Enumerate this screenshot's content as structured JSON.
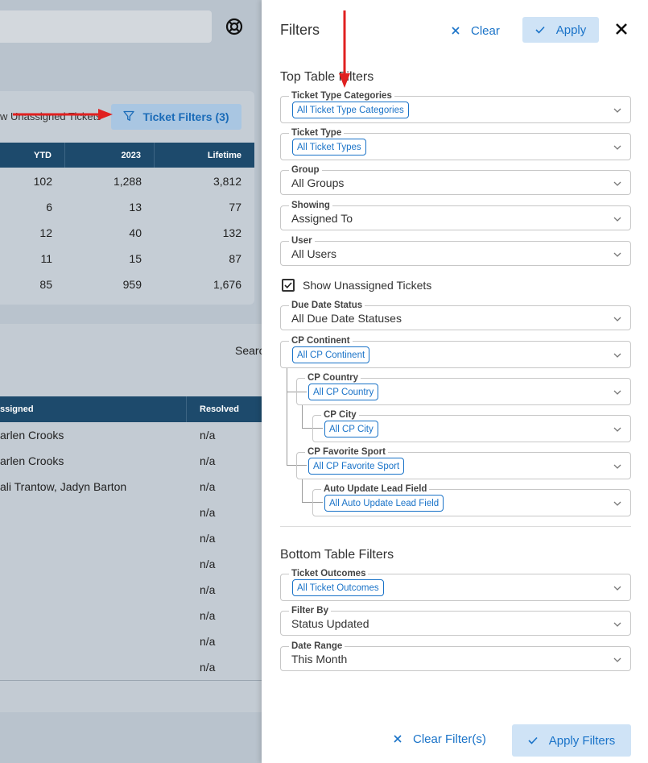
{
  "background": {
    "show_unassigned_label": "w Unassigned Tickets",
    "ticket_filters_button": "Ticket Filters (3)",
    "top_table": {
      "headers": [
        "YTD",
        "2023",
        "Lifetime"
      ],
      "rows": [
        [
          "102",
          "1,288",
          "3,812"
        ],
        [
          "6",
          "13",
          "77"
        ],
        [
          "12",
          "40",
          "132"
        ],
        [
          "11",
          "15",
          "87"
        ],
        [
          "85",
          "959",
          "1,676"
        ]
      ]
    },
    "search_label": "Searc",
    "bottom_table": {
      "headers": [
        "ssigned",
        "Resolved"
      ],
      "rows": [
        [
          "arlen Crooks",
          "n/a"
        ],
        [
          "arlen Crooks",
          "n/a"
        ],
        [
          "ali Trantow,  Jadyn Barton",
          "n/a"
        ],
        [
          "",
          "n/a"
        ],
        [
          "",
          "n/a"
        ],
        [
          "",
          "n/a"
        ],
        [
          "",
          "n/a"
        ],
        [
          "",
          "n/a"
        ],
        [
          "",
          "n/a"
        ],
        [
          "",
          "n/a"
        ]
      ]
    }
  },
  "panel": {
    "title": "Filters",
    "clear_label": "Clear",
    "apply_label": "Apply",
    "top_section_title": "Top Table Filters",
    "top_filters": {
      "ticket_type_categories": {
        "label": "Ticket Type Categories",
        "value": "All Ticket Type Categories"
      },
      "ticket_type": {
        "label": "Ticket Type",
        "value": "All Ticket Types"
      },
      "group": {
        "label": "Group",
        "value": "All Groups"
      },
      "showing": {
        "label": "Showing",
        "value": "Assigned To"
      },
      "user": {
        "label": "User",
        "value": "All Users"
      },
      "show_unassigned": {
        "label": "Show Unassigned Tickets",
        "checked": true
      },
      "due_date_status": {
        "label": "Due Date Status",
        "value": "All Due Date Statuses"
      },
      "cp_continent": {
        "label": "CP Continent",
        "value": "All CP Continent"
      },
      "cp_country": {
        "label": "CP Country",
        "value": "All CP Country"
      },
      "cp_city": {
        "label": "CP City",
        "value": "All CP City"
      },
      "cp_favorite_sport": {
        "label": "CP Favorite Sport",
        "value": "All CP Favorite Sport"
      },
      "auto_update_lead_field": {
        "label": "Auto Update Lead Field",
        "value": "All Auto Update Lead Field"
      }
    },
    "bottom_section_title": "Bottom Table Filters",
    "bottom_filters": {
      "ticket_outcomes": {
        "label": "Ticket Outcomes",
        "value": "All Ticket Outcomes"
      },
      "filter_by": {
        "label": "Filter By",
        "value": "Status Updated"
      },
      "date_range": {
        "label": "Date Range",
        "value": "This Month"
      }
    },
    "footer": {
      "clear_filters_label": "Clear Filter(s)",
      "apply_filters_label": "Apply Filters"
    }
  },
  "colors": {
    "accent": "#1a73c8",
    "header_navy": "#1d4a6c",
    "annotation_red": "#e02020"
  },
  "icons": [
    "help-ring-icon",
    "filter-funnel-icon",
    "check-icon",
    "close-icon",
    "chevron-down-icon",
    "checkbox-checked-icon",
    "annotation-arrow-icon"
  ]
}
